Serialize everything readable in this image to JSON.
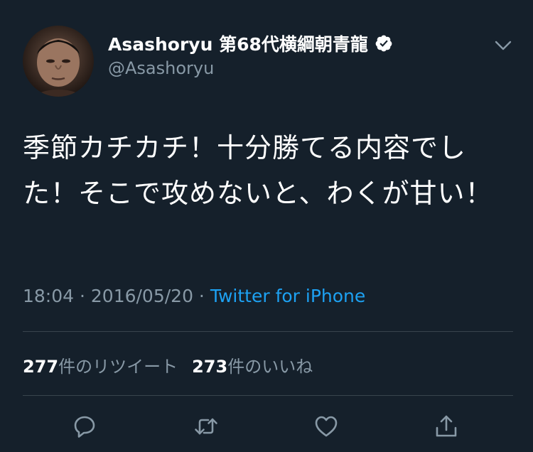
{
  "author": {
    "display_name": "Asashoryu 第68代横綱朝青龍",
    "handle": "@Asashoryu",
    "verified": true
  },
  "tweet": {
    "text": "季節カチカチ！十分勝てる内容でした！そこで攻めないと、わくが甘い！",
    "time": "18:04",
    "separator": " · ",
    "date": "2016/05/20",
    "source": "Twitter for iPhone"
  },
  "stats": {
    "retweets_count": "277",
    "retweets_label": "件のリツイート",
    "likes_count": "273",
    "likes_label": "件のいいね"
  },
  "actions": {
    "icons": [
      "reply-icon",
      "retweet-icon",
      "like-icon",
      "share-icon"
    ]
  },
  "colors": {
    "background": "#15202b",
    "text": "#ffffff",
    "secondary": "#8899a6",
    "link": "#1da1f2",
    "divider": "#38444d"
  }
}
